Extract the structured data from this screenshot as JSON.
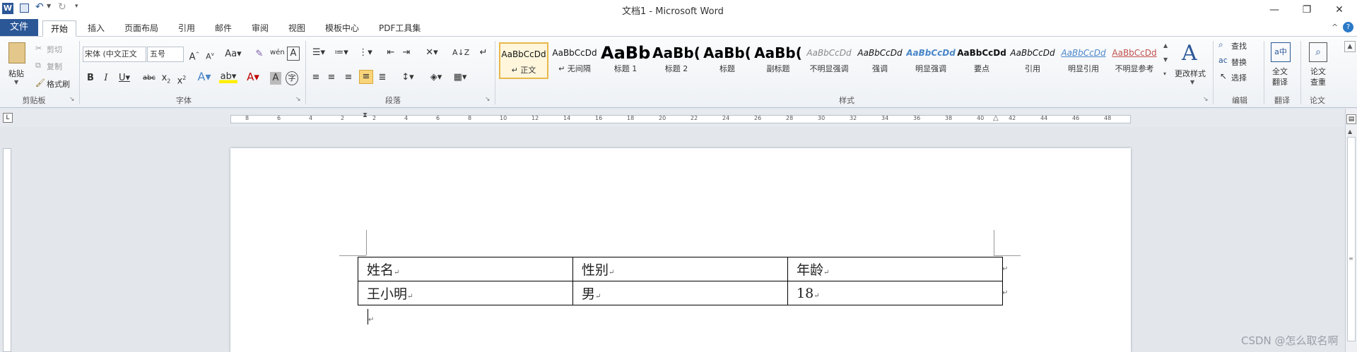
{
  "title_bar": {
    "title": "文档1 - Microsoft Word",
    "quick_access": [
      "save-icon",
      "undo-icon",
      "redo-icon",
      "customize-icon"
    ]
  },
  "tabs": {
    "file": "文件",
    "items": [
      "开始",
      "插入",
      "页面布局",
      "引用",
      "邮件",
      "审阅",
      "视图",
      "模板中心",
      "PDF工具集"
    ]
  },
  "ribbon": {
    "clipboard": {
      "paste": "粘贴",
      "cut": "剪切",
      "copy": "复制",
      "format_painter": "格式刷",
      "group": "剪贴板"
    },
    "font": {
      "font_name": "宋体 (中文正文",
      "font_size": "五号",
      "group": "字体"
    },
    "paragraph": {
      "group": "段落"
    },
    "styles": {
      "items": [
        {
          "preview": "AaBbCcDd",
          "name": "↵ 正文"
        },
        {
          "preview": "AaBbCcDd",
          "name": "↵ 无间隔"
        },
        {
          "preview": "AaBb",
          "name": "标题 1"
        },
        {
          "preview": "AaBb(",
          "name": "标题 2"
        },
        {
          "preview": "AaBb(",
          "name": "标题"
        },
        {
          "preview": "AaBb(",
          "name": "副标题"
        },
        {
          "preview": "AaBbCcDd",
          "name": "不明显强调"
        },
        {
          "preview": "AaBbCcDd",
          "name": "强调"
        },
        {
          "preview": "AaBbCcDd",
          "name": "明显强调"
        },
        {
          "preview": "AaBbCcDd",
          "name": "要点"
        },
        {
          "preview": "AaBbCcDd",
          "name": "引用"
        },
        {
          "preview": "AaBbCcDd",
          "name": "明显引用"
        },
        {
          "preview": "AaBbCcDd",
          "name": "不明显参考"
        }
      ],
      "change_styles": "更改样式",
      "group": "样式"
    },
    "editing": {
      "find": "查找",
      "replace": "替换",
      "select": "选择",
      "group": "编辑"
    },
    "translate": {
      "full": "全文\n翻译",
      "group": "翻译"
    },
    "paper": {
      "check": "论文\n查重",
      "group": "论文"
    }
  },
  "ruler": {
    "labels": [
      "8",
      "6",
      "4",
      "2",
      "2",
      "4",
      "6",
      "8",
      "10",
      "12",
      "14",
      "16",
      "18",
      "20",
      "22",
      "24",
      "26",
      "28",
      "30",
      "32",
      "34",
      "36",
      "38",
      "40",
      "42",
      "44",
      "46",
      "48"
    ]
  },
  "document": {
    "table": [
      [
        "姓名",
        "性别",
        "年龄"
      ],
      [
        "王小明",
        "男",
        "18"
      ]
    ]
  },
  "watermark": "CSDN @怎么取名啊"
}
